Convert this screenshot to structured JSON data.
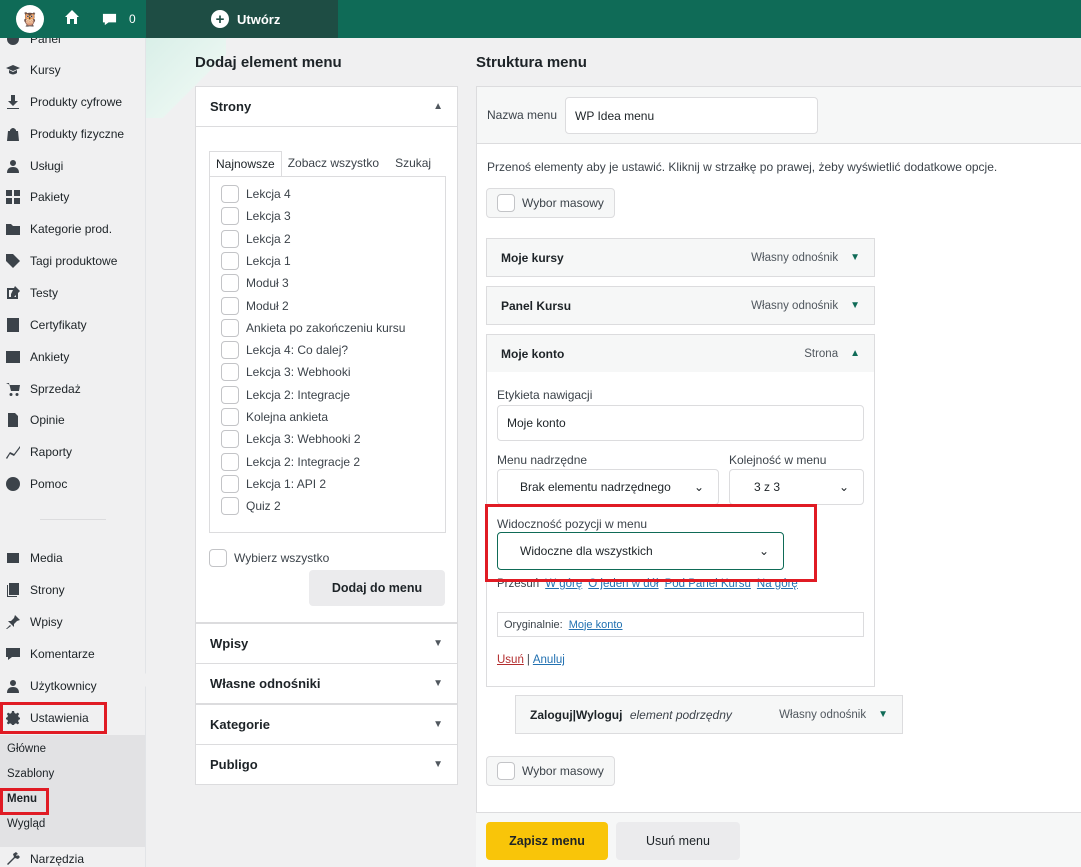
{
  "topbar": {
    "comment_count": "0",
    "create_label": "Utwórz"
  },
  "sidebar": {
    "partial_label": "Panel",
    "items": [
      {
        "label": "Kursy",
        "icon": "graduation-cap-icon"
      },
      {
        "label": "Produkty cyfrowe",
        "icon": "download-icon"
      },
      {
        "label": "Produkty fizyczne",
        "icon": "bag-icon"
      },
      {
        "label": "Usługi",
        "icon": "user-icon"
      },
      {
        "label": "Pakiety",
        "icon": "grid-icon"
      },
      {
        "label": "Kategorie prod.",
        "icon": "folder-icon"
      },
      {
        "label": "Tagi produktowe",
        "icon": "tag-icon"
      },
      {
        "label": "Testy",
        "icon": "edit-icon"
      },
      {
        "label": "Certyfikaty",
        "icon": "document-icon"
      },
      {
        "label": "Ankiety",
        "icon": "list-icon"
      },
      {
        "label": "Sprzedaż",
        "icon": "cart-icon"
      },
      {
        "label": "Opinie",
        "icon": "page-icon"
      },
      {
        "label": "Raporty",
        "icon": "chart-icon"
      },
      {
        "label": "Pomoc",
        "icon": "help-icon"
      }
    ],
    "items2": [
      {
        "label": "Media",
        "icon": "media-icon"
      },
      {
        "label": "Strony",
        "icon": "pages-icon"
      },
      {
        "label": "Wpisy",
        "icon": "pin-icon"
      },
      {
        "label": "Komentarze",
        "icon": "comment-icon"
      },
      {
        "label": "Użytkownicy",
        "icon": "users-icon"
      },
      {
        "label": "Ustawienia",
        "icon": "settings-icon"
      }
    ],
    "submenu": [
      "Główne",
      "Szablony",
      "Menu",
      "Wygląd"
    ],
    "tools_label": "Narzędzia"
  },
  "left": {
    "title": "Dodaj element menu",
    "pages_header": "Strony",
    "tabs": [
      "Najnowsze",
      "Zobacz wszystko",
      "Szukaj"
    ],
    "pages": [
      "Lekcja 4",
      "Lekcja 3",
      "Lekcja 2",
      "Lekcja 1",
      "Moduł 3",
      "Moduł 2",
      "Ankieta po zakończeniu kursu",
      "Lekcja 4: Co dalej?",
      "Lekcja 3: Webhooki",
      "Lekcja 2: Integracje",
      "Kolejna ankieta",
      "Lekcja 3: Webhooki 2",
      "Lekcja 2: Integracje 2",
      "Lekcja 1: API 2",
      "Quiz 2"
    ],
    "select_all": "Wybierz wszystko",
    "add_button": "Dodaj do menu",
    "sections": [
      "Wpisy",
      "Własne odnośniki",
      "Kategorie",
      "Publigo"
    ]
  },
  "right": {
    "title": "Struktura menu",
    "menu_name_label": "Nazwa menu",
    "menu_name_value": "WP Idea menu",
    "instructions": "Przenoś elementy aby je ustawić. Kliknij w strzałkę po prawej, żeby wyświetlić dodatkowe opcje.",
    "mass_select": "Wybor masowy",
    "items": [
      {
        "title": "Moje kursy",
        "type": "Własny odnośnik"
      },
      {
        "title": "Panel Kursu",
        "type": "Własny odnośnik"
      },
      {
        "title": "Moje konto",
        "type": "Strona"
      }
    ],
    "expanded": {
      "nav_label_label": "Etykieta nawigacji",
      "nav_label_value": "Moje konto",
      "parent_label": "Menu nadrzędne",
      "parent_value": "Brak elementu nadrzędnego",
      "order_label": "Kolejność w menu",
      "order_value": "3 z 3",
      "visibility_label": "Widoczność pozycji w menu",
      "visibility_value": "Widoczne dla wszystkich",
      "move_label": "Przesuń",
      "move_links": [
        "W górę",
        "O jeden w dół",
        "Pod Panel Kursu",
        "Na górę"
      ],
      "original_label": "Oryginalnie:",
      "original_link": "Moje konto",
      "remove": "Usuń",
      "separator": "|",
      "cancel": "Anuluj"
    },
    "child_item": {
      "title": "Zaloguj|Wyloguj",
      "sub": "element podrzędny",
      "type": "Własny odnośnik"
    },
    "save_button": "Zapisz menu",
    "delete_button": "Usuń menu"
  }
}
